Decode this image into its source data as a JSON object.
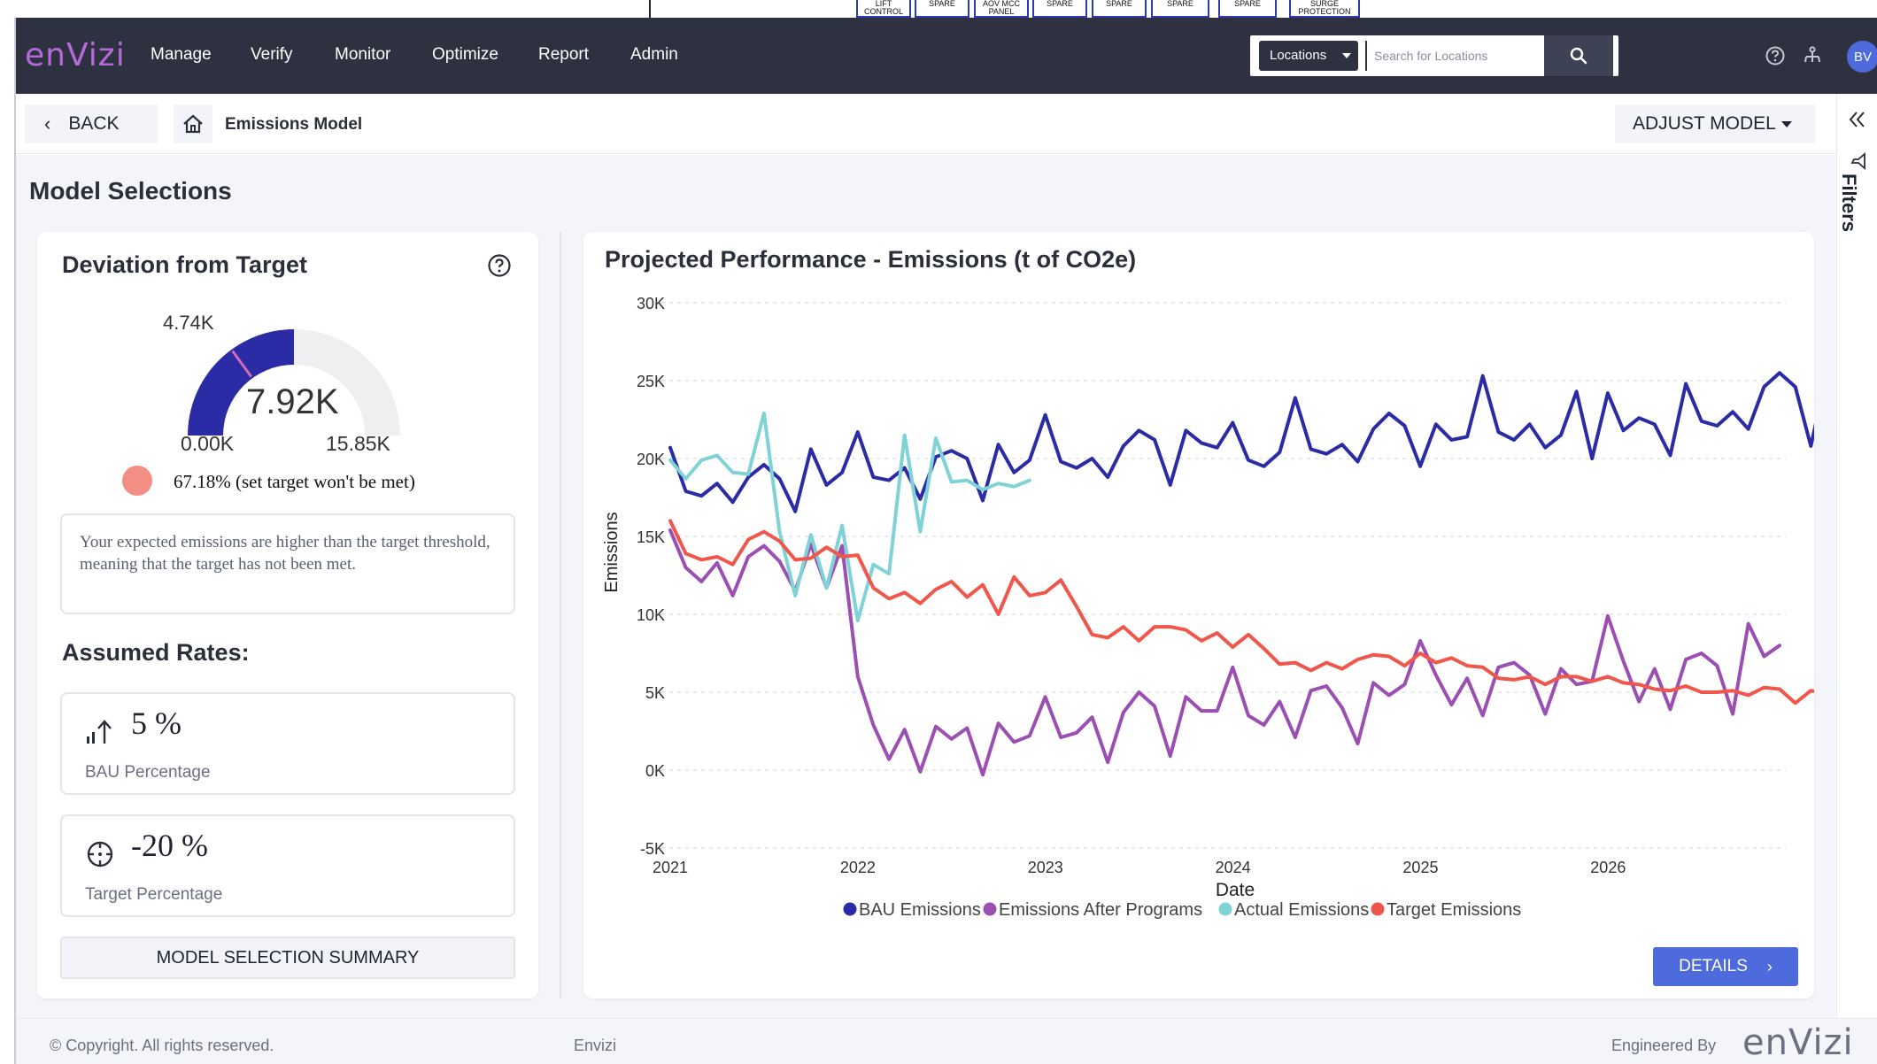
{
  "top_strip": {
    "boxes": [
      "LIFT CONTROL",
      "SPARE",
      "AOV MCC PANEL",
      "SPARE",
      "SPARE",
      "SPARE",
      "SPARE",
      "SURGE PROTECTION"
    ]
  },
  "navbar": {
    "logo": "enVizi",
    "items": [
      "Manage",
      "Verify",
      "Monitor",
      "Optimize",
      "Report",
      "Admin"
    ],
    "location_select": "Locations",
    "search_placeholder": "Search for Locations",
    "avatar_initials": "BV"
  },
  "breadcrumb": {
    "back_label": "BACK",
    "title": "Emissions Model",
    "adjust_label": "ADJUST MODEL"
  },
  "rail": {
    "filters_label": "Filters"
  },
  "main": {
    "section_title": "Model Selections"
  },
  "deviation": {
    "title": "Deviation from Target",
    "gauge_value": "7.92K",
    "gauge_target": "4.74K",
    "gauge_min": "0.00K",
    "gauge_max": "15.85K",
    "gauge_fraction": 0.5,
    "target_fraction": 0.3,
    "status_text": "67.18% (set target won't be met)",
    "status_color": "#f28e84",
    "message": "Your expected emissions are higher than the target threshold, meaning that the target has not been met."
  },
  "rates": {
    "title": "Assumed Rates:",
    "bau_value": "5 %",
    "bau_label": "BAU Percentage",
    "target_value": "-20 %",
    "target_label": "Target Percentage",
    "summary_label": "MODEL SELECTION SUMMARY"
  },
  "chart": {
    "title": "Projected Performance - Emissions (t of CO2e)",
    "details_label": "DETAILS"
  },
  "chart_data": {
    "type": "line",
    "title": "Projected Performance - Emissions (t of CO2e)",
    "xlabel": "Date",
    "ylabel": "Emissions",
    "xlim": [
      2021.0,
      2026.9
    ],
    "ylim": [
      -5000,
      30000
    ],
    "yticks": [
      -5000,
      0,
      5000,
      10000,
      15000,
      20000,
      25000,
      30000
    ],
    "ytick_labels": [
      "-5K",
      "0K",
      "5K",
      "10K",
      "15K",
      "20K",
      "25K",
      "30K"
    ],
    "xticks": [
      "2021",
      "2022",
      "2023",
      "2024",
      "2025",
      "2026"
    ],
    "grid": "horizontal dashed",
    "legend_position": "bottom",
    "series": [
      {
        "name": "BAU Emissions",
        "color": "#2b2ba6",
        "x_start": 2021.0,
        "x_step": 0.0833,
        "values": [
          20700,
          17900,
          17600,
          18400,
          17200,
          18800,
          19600,
          18700,
          16600,
          20600,
          18300,
          19100,
          21700,
          18800,
          18600,
          19400,
          17400,
          20100,
          20500,
          20000,
          17300,
          20900,
          19100,
          19900,
          22800,
          19800,
          19400,
          20000,
          18800,
          20800,
          21800,
          21200,
          18300,
          21800,
          21000,
          20700,
          22300,
          19900,
          19500,
          20400,
          23900,
          20600,
          20300,
          20900,
          19800,
          21900,
          22900,
          22100,
          19500,
          22200,
          21200,
          21400,
          25300,
          21700,
          21200,
          22200,
          20700,
          21500,
          24300,
          20000,
          24200,
          21800,
          22600,
          22200,
          20200,
          24800,
          22400,
          22100,
          23000,
          21900,
          24600,
          25500,
          24600,
          20800,
          25400,
          23300,
          24300
        ]
      },
      {
        "name": "Emissions After Programs",
        "color": "#9c4fb3",
        "x_start": 2021.0,
        "x_step": 0.0833,
        "values": [
          15400,
          13000,
          12100,
          13300,
          11200,
          13700,
          14400,
          13400,
          11500,
          14500,
          11700,
          14400,
          6000,
          2900,
          700,
          2600,
          -100,
          2800,
          2000,
          2700,
          -300,
          3000,
          1800,
          2200,
          4700,
          2100,
          2400,
          3400,
          500,
          3700,
          5000,
          4100,
          900,
          4700,
          3800,
          3800,
          6600,
          3500,
          2900,
          4400,
          2100,
          5100,
          5400,
          4000,
          1700,
          5600,
          4800,
          5500,
          8300,
          6100,
          4200,
          5900,
          3500,
          6600,
          6900,
          6100,
          3600,
          6500,
          5500,
          5700,
          9900,
          7000,
          4400,
          6500,
          3900,
          7100,
          7500,
          6700,
          3600,
          9400,
          7300,
          8000
        ]
      },
      {
        "name": "Actual Emissions",
        "color": "#7fd3d6",
        "x_start": 2021.0,
        "x_step": 0.0833,
        "values": [
          19900,
          18700,
          19900,
          20200,
          19100,
          19000,
          22900,
          15300,
          11200,
          15100,
          11700,
          15700,
          9600,
          13200,
          12600,
          21500,
          15300,
          21300,
          18500,
          18600,
          18000,
          18400,
          18200,
          18600
        ]
      },
      {
        "name": "Target Emissions",
        "color": "#f0564a",
        "x_start": 2021.0,
        "x_step": 0.0833,
        "values": [
          16000,
          13900,
          13500,
          13700,
          13200,
          14800,
          15300,
          14700,
          13500,
          13600,
          14300,
          13700,
          13800,
          11700,
          11000,
          11400,
          10700,
          11600,
          12100,
          11100,
          11900,
          10000,
          12400,
          11200,
          11400,
          12200,
          10500,
          8700,
          8500,
          9200,
          8300,
          9200,
          9200,
          9000,
          8300,
          8800,
          7900,
          8700,
          7800,
          6800,
          6900,
          6400,
          6900,
          6500,
          7100,
          7400,
          7300,
          6700,
          7500,
          6900,
          7200,
          6700,
          6600,
          5900,
          5800,
          6000,
          5500,
          6000,
          6000,
          5700,
          6000,
          5600,
          5500,
          5200,
          5100,
          5400,
          5000,
          5000,
          5100,
          4800,
          5300,
          5200,
          4300,
          5100,
          4900,
          4700,
          4900
        ]
      }
    ]
  },
  "footer": {
    "copyright": "© Copyright. All rights reserved.",
    "middle": "Envizi",
    "engineered_by": "Engineered By",
    "logo": "enVizi"
  }
}
